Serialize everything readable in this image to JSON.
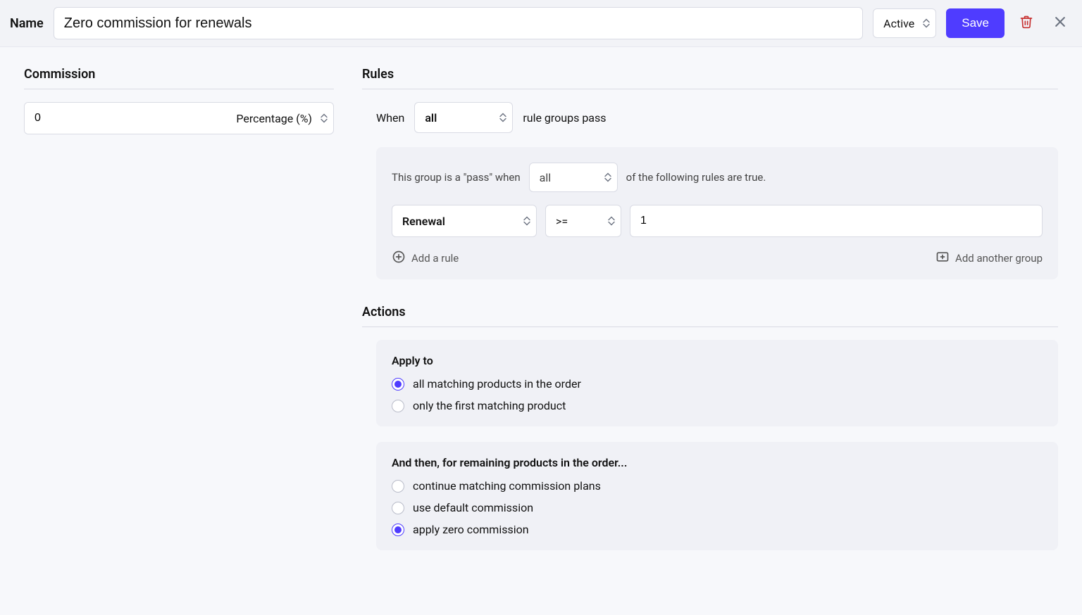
{
  "header": {
    "name_label": "Name",
    "name_value": "Zero commission for renewals",
    "status": "Active",
    "save_label": "Save"
  },
  "commission": {
    "title": "Commission",
    "value": "0",
    "type": "Percentage (%)"
  },
  "rules": {
    "title": "Rules",
    "when_label": "When",
    "when_value": "all",
    "when_suffix": "rule groups pass",
    "group": {
      "prefix": "This group is a \"pass\" when",
      "match": "all",
      "suffix": "of the following rules are true.",
      "rule": {
        "field": "Renewal",
        "op": ">=",
        "value": "1"
      },
      "add_rule": "Add a rule",
      "add_group": "Add another group"
    }
  },
  "actions": {
    "title": "Actions",
    "apply": {
      "heading": "Apply to",
      "options": [
        {
          "label": "all matching products in the order",
          "checked": true
        },
        {
          "label": "only the first matching product",
          "checked": false
        }
      ]
    },
    "remaining": {
      "heading": "And then, for remaining products in the order...",
      "options": [
        {
          "label": "continue matching commission plans",
          "checked": false
        },
        {
          "label": "use default commission",
          "checked": false
        },
        {
          "label": "apply zero commission",
          "checked": true
        }
      ]
    }
  }
}
